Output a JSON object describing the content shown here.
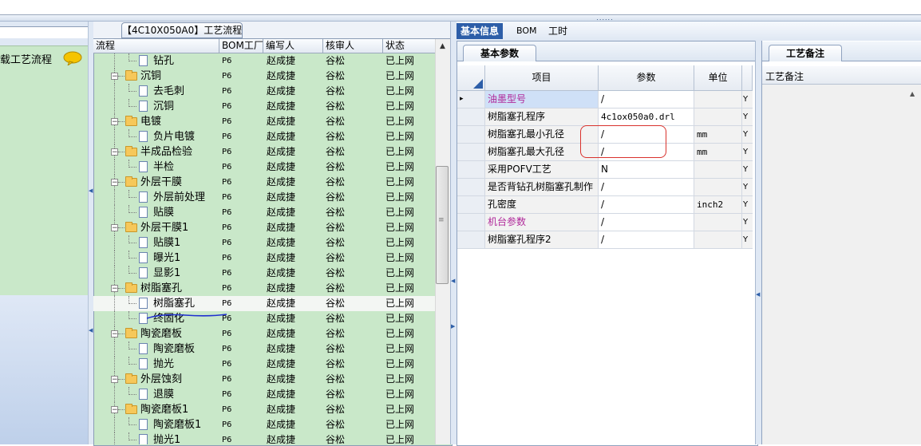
{
  "top_splitter_grip": "......",
  "left_panel": {
    "label": "载工艺流程",
    "icon": "speech-bubble-icon"
  },
  "tree_panel": {
    "tab_title": "【4C10X050A0】工艺流程",
    "columns": [
      "流程",
      "BOM工厂",
      "编写人",
      "核审人",
      "状态"
    ],
    "rows": [
      {
        "name": "钻孔",
        "type": "doc",
        "level": 1,
        "bom": "P6",
        "writer": "赵成捷",
        "reviewer": "谷松",
        "status": "已上网"
      },
      {
        "name": "沉铜",
        "type": "folder",
        "level": 0,
        "bom": "P6",
        "writer": "赵成捷",
        "reviewer": "谷松",
        "status": "已上网"
      },
      {
        "name": "去毛刺",
        "type": "doc",
        "level": 1,
        "bom": "P6",
        "writer": "赵成捷",
        "reviewer": "谷松",
        "status": "已上网"
      },
      {
        "name": "沉铜",
        "type": "doc",
        "level": 1,
        "bom": "P6",
        "writer": "赵成捷",
        "reviewer": "谷松",
        "status": "已上网"
      },
      {
        "name": "电镀",
        "type": "folder",
        "level": 0,
        "bom": "P6",
        "writer": "赵成捷",
        "reviewer": "谷松",
        "status": "已上网"
      },
      {
        "name": "负片电镀",
        "type": "doc",
        "level": 1,
        "bom": "P6",
        "writer": "赵成捷",
        "reviewer": "谷松",
        "status": "已上网"
      },
      {
        "name": "半成品检验",
        "type": "folder",
        "level": 0,
        "bom": "P6",
        "writer": "赵成捷",
        "reviewer": "谷松",
        "status": "已上网"
      },
      {
        "name": "半检",
        "type": "doc",
        "level": 1,
        "bom": "P6",
        "writer": "赵成捷",
        "reviewer": "谷松",
        "status": "已上网"
      },
      {
        "name": "外层干膜",
        "type": "folder",
        "level": 0,
        "bom": "P6",
        "writer": "赵成捷",
        "reviewer": "谷松",
        "status": "已上网"
      },
      {
        "name": "外层前处理",
        "type": "doc",
        "level": 1,
        "bom": "P6",
        "writer": "赵成捷",
        "reviewer": "谷松",
        "status": "已上网"
      },
      {
        "name": "贴膜",
        "type": "doc",
        "level": 1,
        "bom": "P6",
        "writer": "赵成捷",
        "reviewer": "谷松",
        "status": "已上网"
      },
      {
        "name": "外层干膜1",
        "type": "folder",
        "level": 0,
        "bom": "P6",
        "writer": "赵成捷",
        "reviewer": "谷松",
        "status": "已上网"
      },
      {
        "name": "贴膜1",
        "type": "doc",
        "level": 1,
        "bom": "P6",
        "writer": "赵成捷",
        "reviewer": "谷松",
        "status": "已上网"
      },
      {
        "name": "曝光1",
        "type": "doc",
        "level": 1,
        "bom": "P6",
        "writer": "赵成捷",
        "reviewer": "谷松",
        "status": "已上网"
      },
      {
        "name": "显影1",
        "type": "doc",
        "level": 1,
        "bom": "P6",
        "writer": "赵成捷",
        "reviewer": "谷松",
        "status": "已上网"
      },
      {
        "name": "树脂塞孔",
        "type": "folder",
        "level": 0,
        "bom": "P6",
        "writer": "赵成捷",
        "reviewer": "谷松",
        "status": "已上网"
      },
      {
        "name": "树脂塞孔",
        "type": "doc",
        "level": 1,
        "bom": "P6",
        "writer": "赵成捷",
        "reviewer": "谷松",
        "status": "已上网",
        "selected": true
      },
      {
        "name": "终固化",
        "type": "doc",
        "level": 1,
        "bom": "P6",
        "writer": "赵成捷",
        "reviewer": "谷松",
        "status": "已上网"
      },
      {
        "name": "陶瓷磨板",
        "type": "folder",
        "level": 0,
        "bom": "P6",
        "writer": "赵成捷",
        "reviewer": "谷松",
        "status": "已上网"
      },
      {
        "name": "陶瓷磨板",
        "type": "doc",
        "level": 1,
        "bom": "P6",
        "writer": "赵成捷",
        "reviewer": "谷松",
        "status": "已上网"
      },
      {
        "name": "抛光",
        "type": "doc",
        "level": 1,
        "bom": "P6",
        "writer": "赵成捷",
        "reviewer": "谷松",
        "status": "已上网"
      },
      {
        "name": "外层蚀刻",
        "type": "folder",
        "level": 0,
        "bom": "P6",
        "writer": "赵成捷",
        "reviewer": "谷松",
        "status": "已上网"
      },
      {
        "name": "退膜",
        "type": "doc",
        "level": 1,
        "bom": "P6",
        "writer": "赵成捷",
        "reviewer": "谷松",
        "status": "已上网"
      },
      {
        "name": "陶瓷磨板1",
        "type": "folder",
        "level": 0,
        "bom": "P6",
        "writer": "赵成捷",
        "reviewer": "谷松",
        "status": "已上网"
      },
      {
        "name": "陶瓷磨板1",
        "type": "doc",
        "level": 1,
        "bom": "P6",
        "writer": "赵成捷",
        "reviewer": "谷松",
        "status": "已上网"
      },
      {
        "name": "抛光1",
        "type": "doc",
        "level": 1,
        "bom": "P6",
        "writer": "赵成捷",
        "reviewer": "谷松",
        "status": "已上网"
      }
    ]
  },
  "right_tabs": [
    "基本信息",
    "BOM",
    "工时"
  ],
  "params_panel": {
    "subtab": "基本参数",
    "columns": [
      "项目",
      "参数",
      "单位"
    ],
    "rows": [
      {
        "item": "油墨型号",
        "value": "/",
        "unit": "",
        "flag": "Y",
        "highlight": true,
        "current": true
      },
      {
        "item": "树脂塞孔程序",
        "value": "4c1ox050a0.drl",
        "unit": "",
        "flag": "Y"
      },
      {
        "item": "树脂塞孔最小孔径",
        "value": "/",
        "unit": "mm",
        "flag": "Y"
      },
      {
        "item": "树脂塞孔最大孔径",
        "value": "/",
        "unit": "mm",
        "flag": "Y"
      },
      {
        "item": "采用POFV工艺",
        "value": "N",
        "unit": "",
        "flag": "Y"
      },
      {
        "item": "是否背钻孔树脂塞孔制作",
        "value": "/",
        "unit": "",
        "flag": "Y"
      },
      {
        "item": "孔密度",
        "value": "/",
        "unit": "inch2",
        "flag": "Y"
      },
      {
        "item": "机台参数",
        "value": "/",
        "unit": "",
        "flag": "Y",
        "highlight": true
      },
      {
        "item": "树脂塞孔程序2",
        "value": "/",
        "unit": "",
        "flag": "Y"
      }
    ],
    "highlight_color": "#b0289a",
    "annotation_color": "#d9322d"
  },
  "notes_panel": {
    "tab": "工艺备注",
    "label": "工艺备注"
  }
}
